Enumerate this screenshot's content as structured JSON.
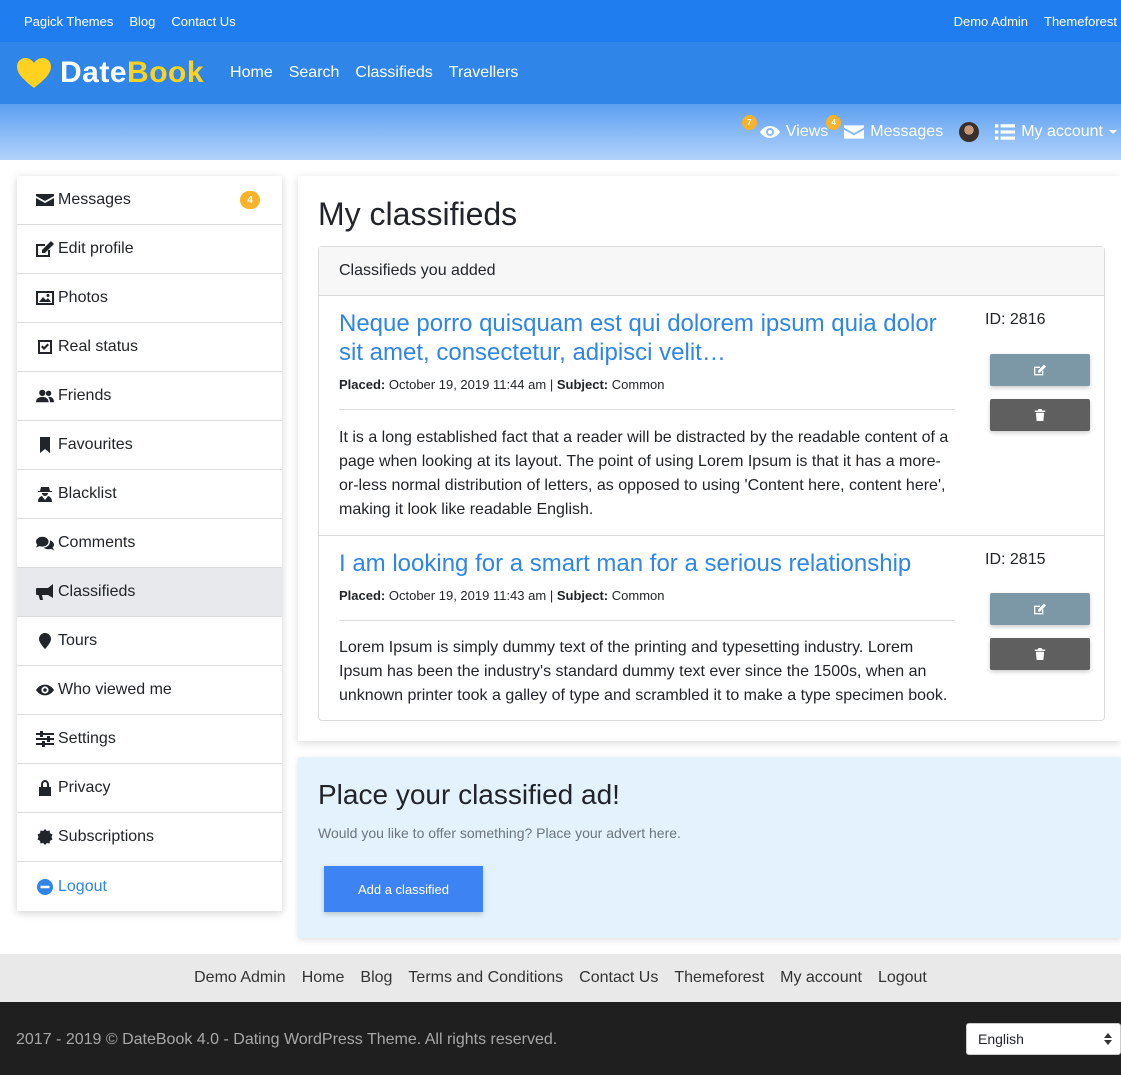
{
  "topbar": {
    "left_links": [
      "Pagick Themes",
      "Blog",
      "Contact Us"
    ],
    "right_links": [
      "Demo Admin",
      "Themeforest"
    ]
  },
  "brand": {
    "part1": "Date",
    "part2": "Book"
  },
  "mainnav": {
    "items": [
      "Home",
      "Search",
      "Classifieds",
      "Travellers"
    ]
  },
  "subbar": {
    "views_label": "Views",
    "views_count": "7",
    "messages_label": "Messages",
    "messages_count": "4",
    "account_label": "My account"
  },
  "sidebar": {
    "items": [
      {
        "label": "Messages",
        "icon": "envelope-icon",
        "count": "4"
      },
      {
        "label": "Edit profile",
        "icon": "edit-icon"
      },
      {
        "label": "Photos",
        "icon": "image-icon"
      },
      {
        "label": "Real status",
        "icon": "check-square-icon"
      },
      {
        "label": "Friends",
        "icon": "users-icon"
      },
      {
        "label": "Favourites",
        "icon": "bookmark-icon"
      },
      {
        "label": "Blacklist",
        "icon": "user-secret-icon"
      },
      {
        "label": "Comments",
        "icon": "comments-icon"
      },
      {
        "label": "Classifieds",
        "icon": "bullhorn-icon",
        "active": true
      },
      {
        "label": "Tours",
        "icon": "map-marker-icon"
      },
      {
        "label": "Who viewed me",
        "icon": "eye-icon"
      },
      {
        "label": "Settings",
        "icon": "sliders-icon"
      },
      {
        "label": "Privacy",
        "icon": "lock-icon"
      },
      {
        "label": "Subscriptions",
        "icon": "certificate-icon"
      },
      {
        "label": "Logout",
        "icon": "minus-circle-icon"
      }
    ]
  },
  "main": {
    "title": "My classifieds",
    "panel_header": "Classifieds you added",
    "entries": [
      {
        "title": "Neque porro quisquam est qui dolorem ipsum quia dolor sit amet, consectetur, adipisci velit…",
        "placed_label": "Placed:",
        "placed_value": "October 19, 2019 11:44 am",
        "separator": "|",
        "subject_label": "Subject:",
        "subject_value": "Common",
        "text": "It is a long established fact that a reader will be distracted by the readable content of a page when looking at its layout. The point of using Lorem Ipsum is that it has a more-or-less normal distribution of letters, as opposed to using 'Content here, content here', making it look like readable English.",
        "id_label": "ID: 2816"
      },
      {
        "title": "I am looking for a smart man for a serious relationship",
        "placed_label": "Placed:",
        "placed_value": "October 19, 2019 11:43 am",
        "separator": "|",
        "subject_label": "Subject:",
        "subject_value": "Common",
        "text": "Lorem Ipsum is simply dummy text of the printing and typesetting industry. Lorem Ipsum has been the industry's standard dummy text ever since the 1500s, when an unknown printer took a galley of type and scrambled it to make a type specimen book.",
        "id_label": "ID: 2815"
      }
    ]
  },
  "cta": {
    "title": "Place your classified ad!",
    "subtitle": "Would you like to offer something? Place your advert here.",
    "button": "Add a classified"
  },
  "footer": {
    "links": [
      "Demo Admin",
      "Home",
      "Blog",
      "Terms and Conditions",
      "Contact Us",
      "Themeforest",
      "My account",
      "Logout"
    ],
    "copyright": "2017 - 2019 © DateBook 4.0 - Dating WordPress Theme. All rights reserved.",
    "language": "English"
  },
  "colors": {
    "topbar": "#1f7df0",
    "nav": "#2f86e8",
    "brand_accent": "#ffd21f",
    "badge": "#f7b32b",
    "link": "#2f86e8",
    "button_primary": "#3e83f4",
    "edit_button": "#7c97a6",
    "delete_button": "#5f5f5f"
  }
}
